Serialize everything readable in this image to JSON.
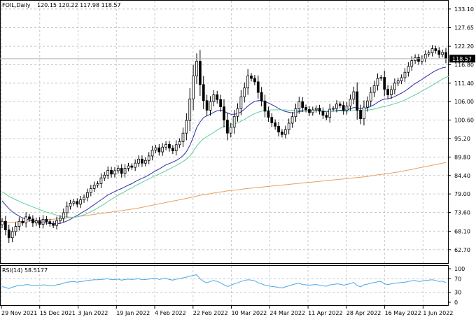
{
  "header": {
    "symbol": "FOIL,Daily",
    "ohlc": "120.15 120.22 117.98 118.57"
  },
  "current_price_label": "118.57",
  "rsi_label": "RSI(14) 58.5177",
  "colors": {
    "candle": "#000000",
    "ema_fast": "#5fcf9f",
    "ema_mid": "#2e2ea8",
    "ema_slow": "#e8a060",
    "rsi": "#4aa8e8",
    "grid": "#c8c8c8",
    "last_price": "#b0b0b0"
  },
  "chart_data": [
    {
      "type": "candlestick",
      "yticks": [
        "133.10",
        "127.65",
        "122.20",
        "116.80",
        "111.40",
        "106.00",
        "100.60",
        "95.20",
        "89.80",
        "84.40",
        "79.00",
        "73.60",
        "68.10",
        "62.70"
      ],
      "xticks": [
        "29 Nov 2021",
        "15 Dec 2021",
        "3 Jan 2022",
        "19 Jan 2022",
        "4 Feb 2022",
        "22 Feb 2022",
        "10 Mar 2022",
        "24 Mar 2022",
        "11 Apr 2022",
        "28 Apr 2022",
        "16 May 2022",
        "1 Jun 2022"
      ],
      "ylim": [
        60,
        134.5
      ],
      "last_price": 118.57,
      "closes": [
        71.0,
        68.5,
        66.2,
        68.0,
        69.5,
        71.0,
        70.5,
        72.3,
        71.7,
        70.5,
        71.2,
        70.1,
        71.6,
        70.9,
        70.3,
        69.8,
        71.2,
        71.9,
        73.5,
        75.4,
        76.3,
        76.8,
        76.0,
        77.3,
        78.0,
        79.4,
        80.6,
        81.6,
        82.0,
        83.7,
        84.5,
        85.9,
        84.8,
        85.8,
        86.5,
        85.0,
        86.5,
        87.2,
        86.8,
        88.0,
        89.2,
        88.0,
        88.8,
        90.1,
        91.8,
        92.5,
        91.3,
        92.7,
        93.5,
        92.4,
        91.6,
        93.4,
        94.3,
        96.8,
        100.5,
        106.8,
        113.5,
        117.8,
        111.0,
        106.3,
        103.5,
        106.0,
        108.0,
        106.6,
        104.5,
        100.6,
        96.8,
        98.5,
        101.7,
        104.0,
        107.4,
        110.0,
        113.5,
        112.8,
        111.8,
        108.7,
        106.2,
        103.2,
        101.4,
        99.8,
        98.8,
        97.1,
        96.4,
        97.8,
        99.7,
        101.6,
        103.9,
        106.0,
        104.3,
        103.7,
        102.8,
        103.6,
        104.1,
        103.2,
        102.0,
        101.4,
        103.8,
        104.0,
        105.3,
        104.9,
        103.4,
        104.7,
        106.7,
        108.9,
        103.5,
        101.0,
        104.4,
        106.2,
        108.7,
        110.7,
        112.8,
        113.1,
        109.6,
        108.0,
        109.5,
        111.4,
        112.1,
        113.0,
        114.6,
        116.3,
        118.0,
        118.9,
        117.8,
        118.6,
        119.9,
        120.3,
        121.5,
        120.9,
        119.8,
        120.4,
        118.57
      ],
      "series": [
        {
          "values": [
            79.6,
            79.0,
            78.3,
            77.8,
            77.3,
            76.9,
            76.4,
            76.0,
            75.6,
            75.2,
            74.8,
            74.4,
            74.1,
            73.7,
            73.4,
            73.1,
            72.8,
            72.5,
            72.3,
            72.3,
            72.2,
            72.2,
            72.3,
            72.6,
            72.9,
            73.3,
            73.8,
            74.3,
            74.9,
            75.5,
            76.1,
            76.8,
            77.4,
            78.0,
            78.6,
            79.2,
            79.7,
            80.3,
            80.8,
            81.4,
            81.9,
            82.4,
            82.9,
            83.4,
            83.9,
            84.4,
            84.8,
            85.3,
            85.8,
            86.3,
            86.8,
            87.3,
            87.9,
            88.5,
            89.2,
            90.1,
            91.5,
            93.0,
            94.2,
            95.1,
            95.8,
            96.4,
            97.0,
            97.7,
            98.3,
            98.7,
            99.0,
            99.2,
            99.5,
            99.8,
            100.3,
            100.8,
            101.4,
            102.0,
            102.5,
            102.9,
            103.2,
            103.4,
            103.5,
            103.6,
            103.6,
            103.6,
            103.6,
            103.6,
            103.5,
            103.5,
            103.5,
            103.5,
            103.4,
            103.4,
            103.4,
            103.4,
            103.4,
            103.3,
            103.3,
            103.2,
            103.2,
            103.2,
            103.2,
            103.3,
            103.2,
            103.2,
            103.3,
            103.4,
            103.4,
            103.4,
            103.5,
            103.5,
            103.7,
            103.8,
            104.1,
            104.4,
            104.6,
            104.8,
            105.1,
            105.4,
            105.7,
            106.1,
            106.5,
            107.0,
            107.5,
            108.0,
            108.5,
            109.1,
            109.6,
            110.2,
            110.8,
            111.4,
            112.0,
            112.6,
            113.1,
            113.5
          ]
        },
        {
          "values": [
            77.0,
            75.8,
            74.7,
            73.8,
            73.1,
            72.5,
            72.0,
            71.7,
            71.4,
            71.1,
            70.9,
            70.7,
            70.6,
            70.5,
            70.4,
            70.3,
            70.3,
            70.4,
            70.7,
            71.1,
            71.6,
            72.2,
            72.7,
            73.3,
            73.9,
            74.5,
            75.2,
            75.9,
            76.6,
            77.3,
            78.0,
            78.7,
            79.2,
            79.7,
            80.2,
            80.6,
            81.1,
            81.6,
            82.0,
            82.6,
            83.1,
            83.6,
            84.0,
            84.6,
            85.2,
            85.8,
            86.3,
            86.9,
            87.5,
            87.9,
            88.3,
            88.8,
            89.4,
            90.2,
            91.4,
            93.2,
            95.6,
            98.4,
            100.1,
            101.3,
            101.9,
            102.3,
            102.9,
            103.3,
            103.5,
            103.2,
            102.7,
            102.3,
            102.3,
            102.5,
            103.0,
            103.8,
            104.7,
            105.5,
            106.1,
            106.3,
            106.3,
            106.0,
            105.6,
            105.1,
            104.6,
            104.0,
            103.5,
            103.1,
            102.9,
            102.7,
            102.8,
            103.1,
            103.2,
            103.3,
            103.3,
            103.3,
            103.4,
            103.3,
            103.2,
            103.0,
            103.1,
            103.2,
            103.4,
            103.5,
            103.5,
            103.6,
            103.9,
            104.3,
            104.2,
            104.0,
            104.0,
            104.2,
            104.6,
            105.1,
            105.8,
            106.4,
            106.7,
            106.8,
            107.1,
            107.5,
            108.0,
            108.5,
            109.1,
            109.8,
            110.6,
            111.3,
            111.9,
            112.5,
            113.2,
            113.8,
            114.5,
            115.1,
            115.5,
            115.9,
            116.1
          ]
        },
        {
          "values": [
            70.5,
            70.6,
            70.6,
            70.7,
            70.8,
            70.9,
            70.9,
            71.0,
            71.1,
            71.2,
            71.2,
            71.3,
            71.4,
            71.4,
            71.5,
            71.6,
            71.7,
            71.7,
            71.8,
            72.0,
            72.1,
            72.2,
            72.3,
            72.5,
            72.6,
            72.7,
            72.9,
            73.0,
            73.2,
            73.3,
            73.4,
            73.6,
            73.7,
            73.9,
            74.0,
            74.1,
            74.3,
            74.4,
            74.6,
            74.7,
            74.9,
            75.1,
            75.3,
            75.5,
            75.7,
            75.9,
            76.1,
            76.3,
            76.5,
            76.7,
            76.9,
            77.1,
            77.3,
            77.5,
            77.7,
            77.9,
            78.1,
            78.4,
            78.6,
            78.8,
            78.9,
            79.1,
            79.3,
            79.4,
            79.6,
            79.7,
            79.9,
            80.0,
            80.1,
            80.2,
            80.3,
            80.5,
            80.6,
            80.7,
            80.8,
            80.9,
            81.0,
            81.1,
            81.2,
            81.3,
            81.4,
            81.5,
            81.6,
            81.7,
            81.8,
            81.9,
            82.0,
            82.1,
            82.2,
            82.3,
            82.4,
            82.5,
            82.6,
            82.7,
            82.8,
            82.9,
            83.0,
            83.1,
            83.2,
            83.3,
            83.4,
            83.5,
            83.6,
            83.7,
            83.8,
            83.9,
            84.0,
            84.1,
            84.3,
            84.4,
            84.6,
            84.7,
            84.8,
            85.0,
            85.1,
            85.3,
            85.4,
            85.6,
            85.8,
            86.0,
            86.2,
            86.4,
            86.6,
            86.8,
            87.0,
            87.2,
            87.4,
            87.6,
            87.8,
            88.0,
            88.2
          ]
        }
      ]
    },
    {
      "type": "line",
      "yticks": [
        "100",
        "70",
        "30",
        "0"
      ],
      "ylim": [
        0,
        100
      ],
      "series": [
        {
          "name": "RSI(14)",
          "values": [
            47,
            44,
            41,
            45,
            48,
            51,
            50,
            53,
            52,
            50,
            51,
            49,
            52,
            51,
            50,
            49,
            52,
            54,
            57,
            60,
            61,
            62,
            60,
            62,
            63,
            65,
            66,
            67,
            67,
            68,
            69,
            70,
            67,
            68,
            69,
            66,
            68,
            69,
            68,
            69,
            70,
            67,
            68,
            69,
            71,
            72,
            68,
            70,
            71,
            68,
            66,
            69,
            70,
            73,
            75,
            78,
            80,
            82,
            70,
            62,
            58,
            62,
            65,
            62,
            58,
            52,
            47,
            50,
            55,
            58,
            62,
            65,
            67,
            66,
            64,
            58,
            55,
            51,
            49,
            47,
            46,
            44,
            43,
            46,
            49,
            52,
            55,
            57,
            53,
            52,
            51,
            52,
            53,
            51,
            49,
            48,
            52,
            53,
            55,
            54,
            51,
            53,
            56,
            59,
            50,
            46,
            52,
            54,
            57,
            59,
            61,
            62,
            55,
            53,
            55,
            57,
            58,
            59,
            60,
            62,
            64,
            65,
            62,
            63,
            65,
            66,
            67,
            65,
            62,
            63,
            58.5
          ]
        }
      ]
    }
  ]
}
